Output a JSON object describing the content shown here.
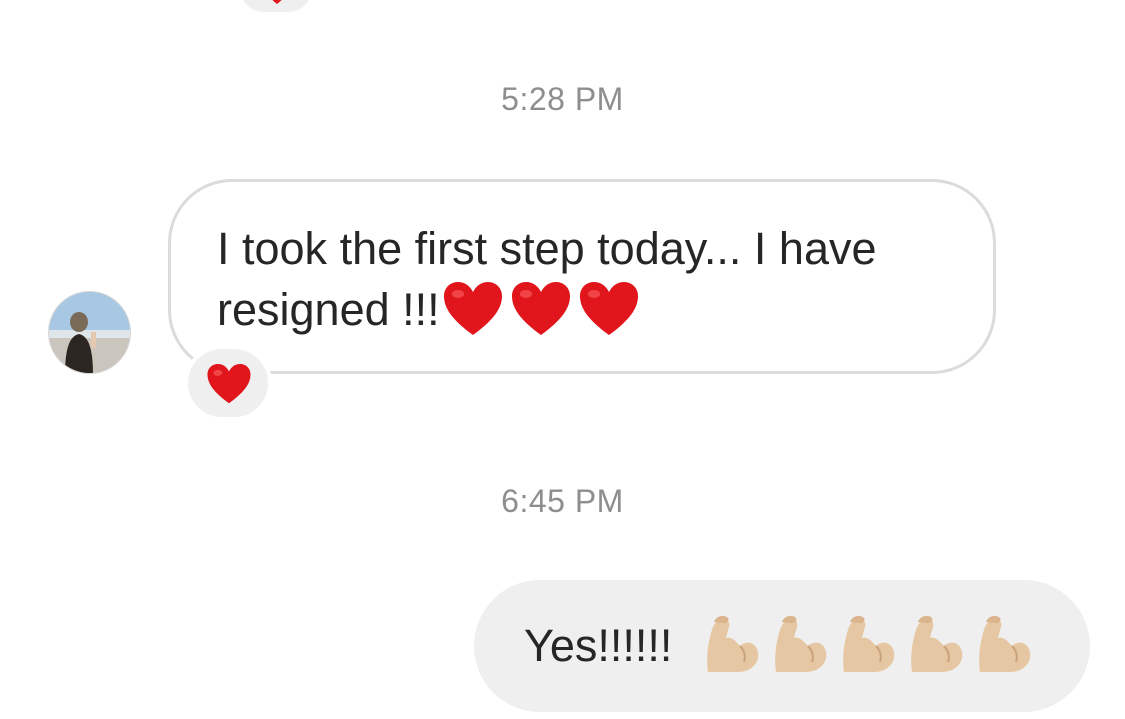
{
  "thread": {
    "prev_reaction": {
      "emoji_icon": "heart-icon"
    },
    "timestamps": [
      "5:28 PM",
      "6:45 PM"
    ],
    "incoming": {
      "text": "I took the first step today... I have resigned !!!",
      "trailing_emojis": [
        "heart-icon",
        "heart-icon",
        "heart-icon"
      ],
      "reaction": "heart-icon"
    },
    "outgoing": {
      "text": "Yes!!!!!!",
      "trailing_emojis": [
        "flexed-biceps-icon",
        "flexed-biceps-icon",
        "flexed-biceps-icon",
        "flexed-biceps-icon",
        "flexed-biceps-icon"
      ]
    }
  },
  "colors": {
    "heart": "#e0161c",
    "bubble_outgoing": "#efefef",
    "bubble_incoming_border": "#dbdbdb",
    "timestamp": "#8e8e8e",
    "text": "#262626",
    "biceps_skin": "#e6c7a3"
  }
}
